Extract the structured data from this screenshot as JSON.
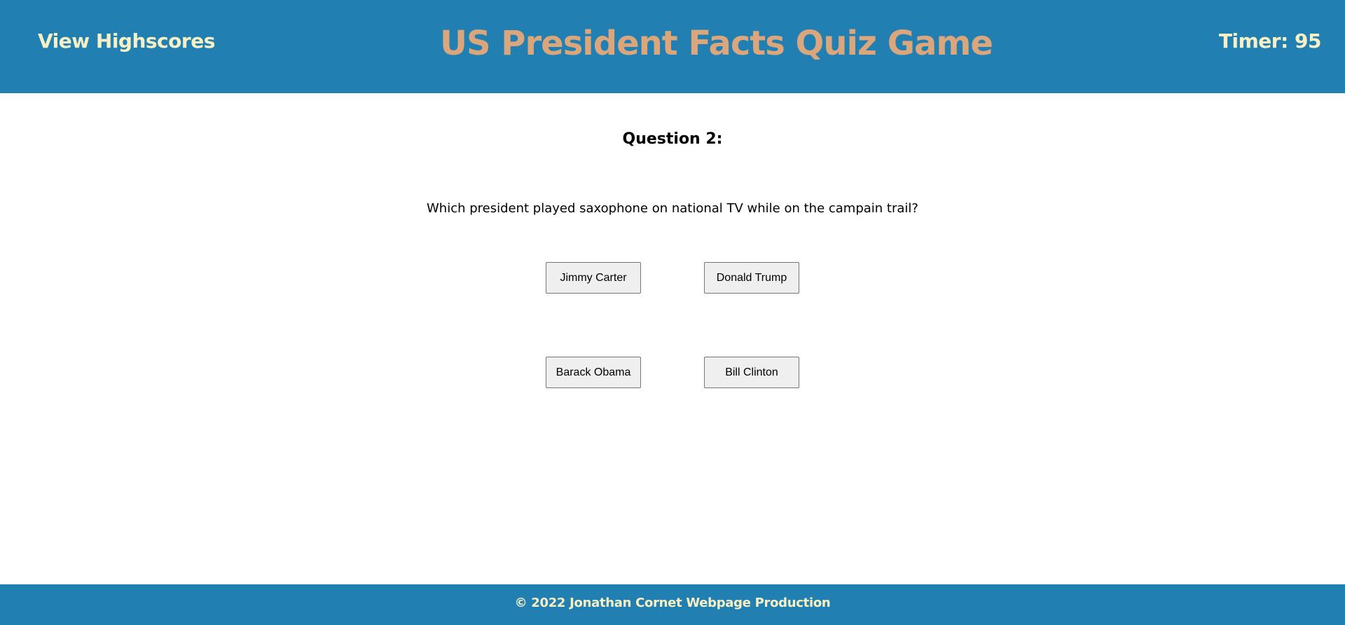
{
  "header": {
    "highscores_label": "View Highscores",
    "title": "US President Facts Quiz Game",
    "timer": "Timer: 95"
  },
  "quiz": {
    "question_heading": "Question 2:",
    "question_text": "Which president played saxophone on national TV while on the campain trail?",
    "answers": [
      "Jimmy Carter",
      "Donald Trump",
      "Barack Obama",
      "Bill Clinton"
    ]
  },
  "footer": {
    "copyright": "© 2022 Jonathan Cornet Webpage Production"
  },
  "colors": {
    "header_bg": "#2180b1",
    "title_color": "#dba67c",
    "nav_text": "#f6f0c4"
  }
}
